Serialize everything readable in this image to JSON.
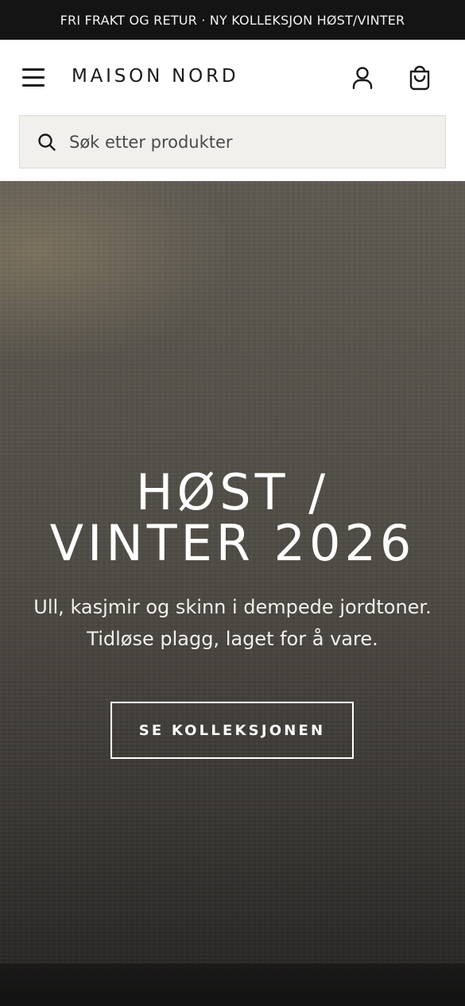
{
  "announcement": {
    "text": "FRI FRAKT OG RETUR · NY KOLLEKSJON HØST/VINTER"
  },
  "header": {
    "brand": "MAISON NORD",
    "icons": {
      "menu": "hamburger-menu-icon",
      "account": "user-icon",
      "cart": "shopping-bag-icon"
    }
  },
  "search": {
    "placeholder": "Søk etter produkter",
    "value": "",
    "icon": "search-icon"
  },
  "hero": {
    "title_line1": "HØST /",
    "title_line2": "VINTER 2026",
    "subtitle_line1": "Ull, kasjmir og skinn i dempede jordtoner.",
    "subtitle_line2": "Tidløse plagg, laget for å vare.",
    "cta_label": "SE KOLLEKSJONEN"
  },
  "colors": {
    "announcement_bg": "#141414",
    "header_bg": "#ffffff",
    "search_bg": "#f1f0ed",
    "hero_text": "#ffffff",
    "brand_text": "#1a1a1a"
  }
}
